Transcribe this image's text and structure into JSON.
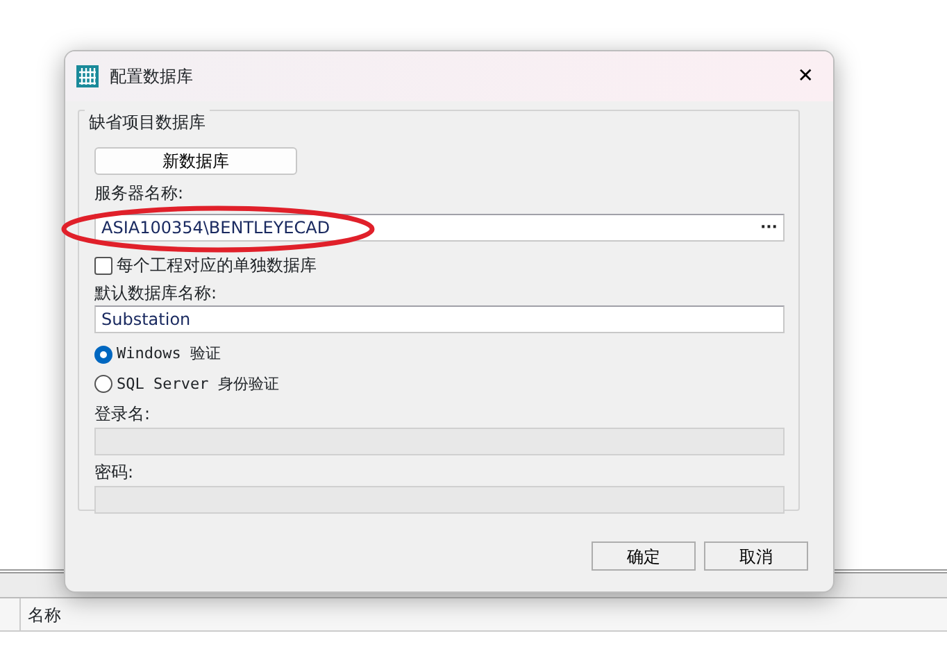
{
  "window": {
    "title": "配置数据库",
    "close": "✕"
  },
  "group": {
    "title": "缺省项目数据库",
    "new_button": "新数据库",
    "server": {
      "label": "服务器名称:",
      "value": "ASIA100354\\BENTLEYECAD",
      "browse": "···"
    },
    "separate": {
      "label": "每个工程对应的单独数据库",
      "checked": false
    },
    "db_name": {
      "label": "默认数据库名称:",
      "value": "Substation"
    },
    "auth": [
      {
        "label": "Windows 验证",
        "selected": true
      },
      {
        "label": "SQL Server 身份验证",
        "selected": false
      }
    ],
    "login": {
      "label": "登录名:",
      "disabled": true
    },
    "password": {
      "label": "密码:",
      "disabled": true
    }
  },
  "buttons": [
    "确定",
    "取消"
  ],
  "background": {
    "column_header": "名称"
  },
  "annotation": {
    "kind": "ellipse",
    "color": "#e0202a"
  }
}
